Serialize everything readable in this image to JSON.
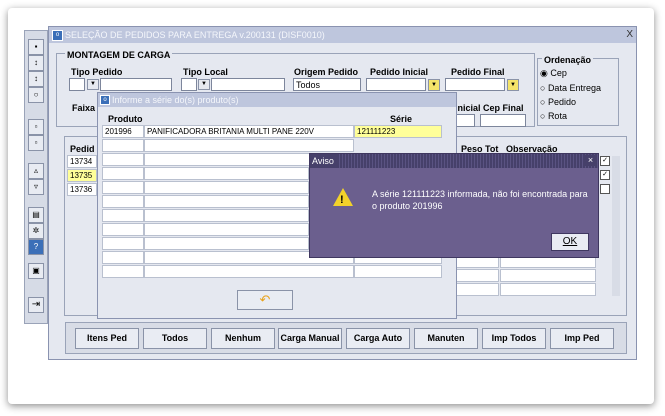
{
  "window": {
    "title": "SELEÇÃO DE PEDIDOS PARA ENTREGA v.200131 (DISF0010)",
    "close": "X"
  },
  "carga": {
    "group_label": "MONTAGEM DE CARGA",
    "tipo_pedido_label": "Tipo Pedido",
    "tipo_local_label": "Tipo Local",
    "origem_label": "Origem Pedido",
    "origem_value": "Todos",
    "pedido_inicial_label": "Pedido Inicial",
    "pedido_final_label": "Pedido Final",
    "faixa_label": "Faixa",
    "inicial_label": "inicial",
    "cep_final_label": "Cep Final"
  },
  "ordenacao": {
    "label": "Ordenação",
    "options": [
      "Cep",
      "Data Entrega",
      "Pedido",
      "Rota"
    ]
  },
  "list": {
    "header_pedido": "Pedid",
    "header_peso": "Peso Tot",
    "header_obs": "Observação",
    "rows": [
      "13734",
      "13735",
      "13736"
    ]
  },
  "buttons": [
    "Itens Ped",
    "Todos",
    "Nenhum",
    "Carga Manual",
    "Carga Auto",
    "Manuten",
    "Imp Todos",
    "Imp Ped"
  ],
  "dialog": {
    "title": "Informe a série do(s) produto(s)",
    "col_produto": "Produto",
    "col_serie": "Série",
    "row": {
      "codigo": "201996",
      "descricao": "PANIFICADORA BRITANIA MULTI PANE 220V",
      "serie": "121111223"
    }
  },
  "aviso": {
    "title": "Aviso",
    "message": "A série 121111223 informada, não foi encontrada para o produto 201996",
    "ok": "OK",
    "close": "×"
  },
  "colors": {
    "title_bar": "#bec6dd",
    "alert_bg": "#6b5f8e",
    "highlight": "#ffff99"
  }
}
